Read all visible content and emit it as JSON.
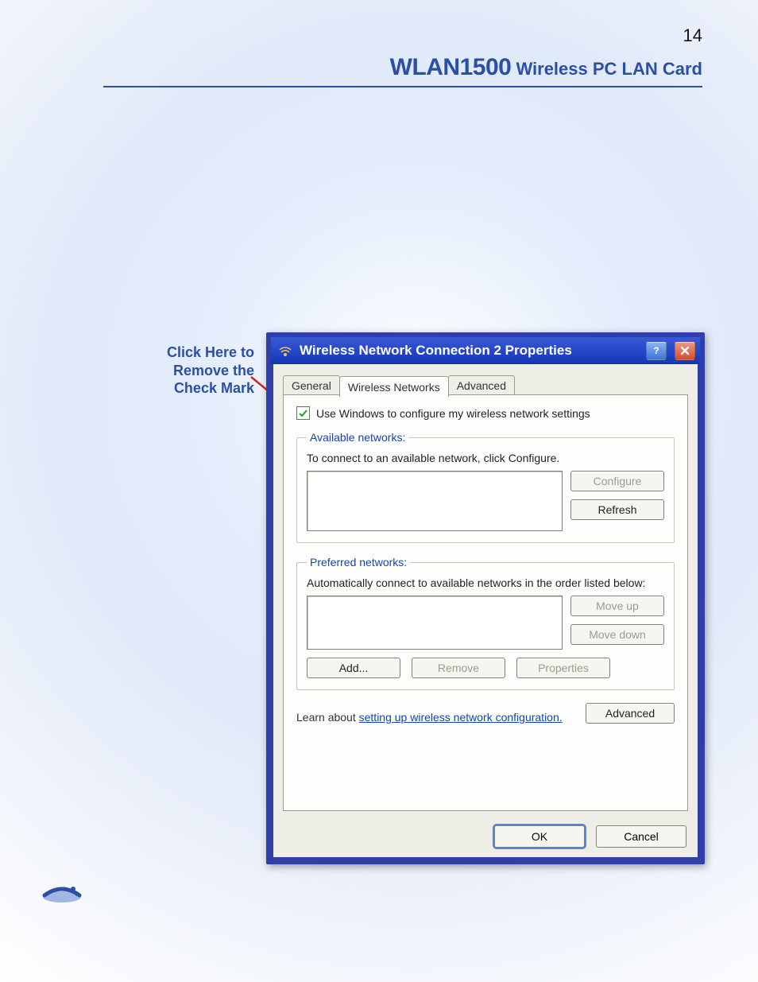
{
  "page_number": "14",
  "header": {
    "title_strong": "WLAN1500",
    "title_rest": " Wireless PC LAN Card"
  },
  "annotation": {
    "line1": "Click Here to",
    "line2": "Remove the",
    "line3": "Check Mark"
  },
  "dialog": {
    "title": "Wireless Network Connection 2 Properties",
    "tabs": {
      "general": "General",
      "wireless": "Wireless Networks",
      "advanced": "Advanced"
    },
    "checkbox_label": "Use Windows to configure my wireless network settings",
    "checkbox_checked": true,
    "available": {
      "legend": "Available networks:",
      "desc": "To connect to an available network, click Configure.",
      "configure": "Configure",
      "refresh": "Refresh"
    },
    "preferred": {
      "legend": "Preferred networks:",
      "desc": "Automatically connect to available networks in the order listed below:",
      "move_up": "Move up",
      "move_down": "Move down",
      "add": "Add...",
      "remove": "Remove",
      "properties": "Properties"
    },
    "learn": {
      "prefix": "Learn about ",
      "link": "setting up wireless network configuration.",
      "advanced": "Advanced"
    },
    "ok": "OK",
    "cancel": "Cancel"
  }
}
